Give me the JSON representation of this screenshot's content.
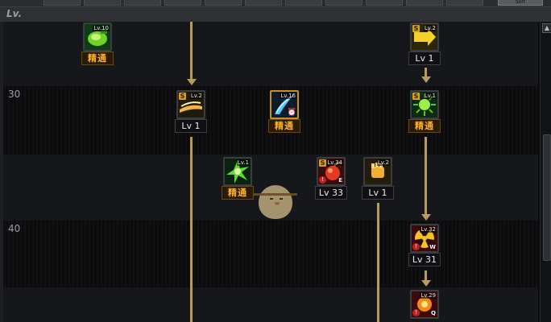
{
  "header": {
    "level_label": "Lv.",
    "sort_label": "Sort"
  },
  "level_markers": [
    "30",
    "40"
  ],
  "icons": {
    "scroll_up": "scroll-up-arrow-icon",
    "clock": "clock-icon",
    "mascot": "owl-mascot-icon"
  },
  "badges": {
    "s": "S",
    "r": "!",
    "e": "E",
    "w": "W",
    "q": "Q"
  },
  "colors": {
    "connector": "#b89b60",
    "mastery_text": "#ffb227",
    "level_text": "#e8e8e8"
  },
  "skills": [
    {
      "icon_level": "Lv.10",
      "label": "精通",
      "kind": "mastery",
      "icon": "green-grenade-icon"
    },
    {
      "icon_level": "Lv.2",
      "label": "Lv 1",
      "kind": "level",
      "icon": "yellow-arrow-icon"
    },
    {
      "icon_level": "Lv.2",
      "label": "Lv 1",
      "kind": "level",
      "icon": "yellow-slash-icon"
    },
    {
      "icon_level": "Lv.16",
      "label": "精通",
      "kind": "mastery",
      "icon": "blue-blade-icon"
    },
    {
      "icon_level": "Lv.1",
      "label": "精通",
      "kind": "mastery",
      "icon": "green-sun-icon"
    },
    {
      "icon_level": "Lv.1",
      "label": "精通",
      "kind": "mastery",
      "icon": "green-burst-icon"
    },
    {
      "icon_level": "Lv.34",
      "label": "Lv 33",
      "kind": "level",
      "icon": "red-bomb-icon"
    },
    {
      "icon_level": "Lv.2",
      "label": "Lv 1",
      "kind": "level",
      "icon": "yellow-fist-icon"
    },
    {
      "icon_level": "Lv.32",
      "label": "Lv 31",
      "kind": "level",
      "icon": "red-nuclear-icon"
    },
    {
      "icon_level": "Lv.29",
      "label": "",
      "kind": "partial",
      "icon": "red-core-icon"
    }
  ]
}
